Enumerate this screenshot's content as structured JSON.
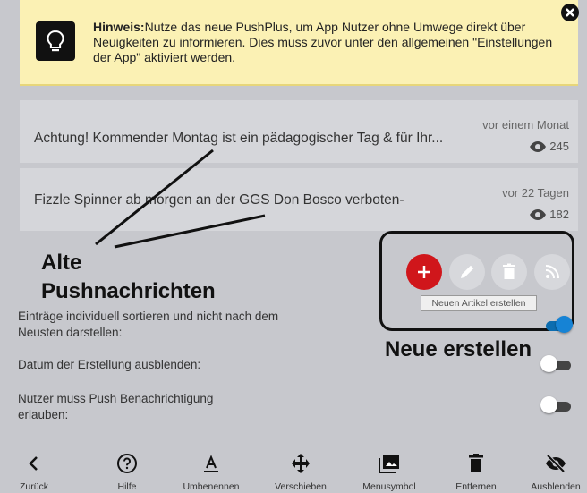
{
  "hint": {
    "bold": "Hinweis:",
    "text": "Nutze das neue PushPlus, um App Nutzer ohne Umwege direkt über Neuigkeiten zu informieren. Dies muss zuvor unter den allgemeinen \"Einstellungen der App\" aktiviert werden."
  },
  "pushes": [
    {
      "title": "Achtung! Kommender Montag ist ein pädagogischer Tag & für Ihr...",
      "age": "vor einem Monat",
      "views": "245"
    },
    {
      "title": "Fizzle Spinner ab morgen an der GGS Don Bosco verboten-",
      "age": "vor 22 Tagen",
      "views": "182"
    }
  ],
  "annotations": {
    "alte_line1": "Alte",
    "alte_line2": "Pushnachrichten",
    "neue": "Neue erstellen"
  },
  "tooltip": "Neuen Artikel erstellen",
  "settings": [
    {
      "label": "Einträge individuell sortieren und nicht nach dem Neusten darstellen:",
      "on": true
    },
    {
      "label": "Datum der Erstellung ausblenden:",
      "on": false
    },
    {
      "label": "Nutzer muss Push Benachrichtigung erlauben:",
      "on": false
    }
  ],
  "toolbar": [
    "Zurück",
    "Hilfe",
    "Umbenennen",
    "Verschieben",
    "Menusymbol",
    "Entfernen",
    "Ausblenden"
  ],
  "colors": {
    "add_button": "#d0161b",
    "toggle_on": "#1683d5",
    "hint_bg": "#fbf1b4"
  }
}
